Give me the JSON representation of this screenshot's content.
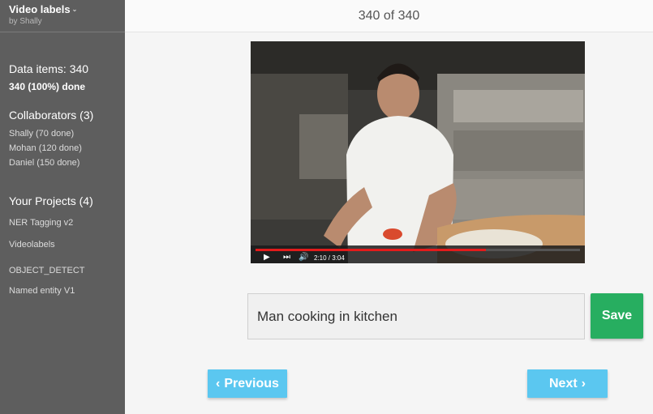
{
  "app": {
    "project_title": "Video labels",
    "owner": "by Shally"
  },
  "sidebar": {
    "data_items": "Data items: 340",
    "done": "340 (100%) done",
    "collaborators_heading": "Collaborators (3)",
    "collaborators": [
      "Shally (70 done)",
      "Mohan (120 done)",
      "Daniel (150 done)"
    ],
    "projects_heading": "Your Projects (4)",
    "projects": [
      "NER Tagging v2",
      "Videolabels",
      "OBJECT_DETECT",
      "Named entity V1"
    ]
  },
  "header": {
    "counter": "340 of 340"
  },
  "video": {
    "time": "2:10 / 3:04",
    "progress": 0.71,
    "icons": [
      "play-icon",
      "next-track-icon",
      "volume-icon"
    ],
    "progress_color": "#e31b1b"
  },
  "label": {
    "value": "Man cooking in kitchen"
  },
  "buttons": {
    "save": "Save",
    "previous": "Previous",
    "next": "Next"
  },
  "colors": {
    "sidebar_bg": "#5e5e5e",
    "save_green": "#27ae60",
    "nav_blue": "#5bc7f0"
  }
}
